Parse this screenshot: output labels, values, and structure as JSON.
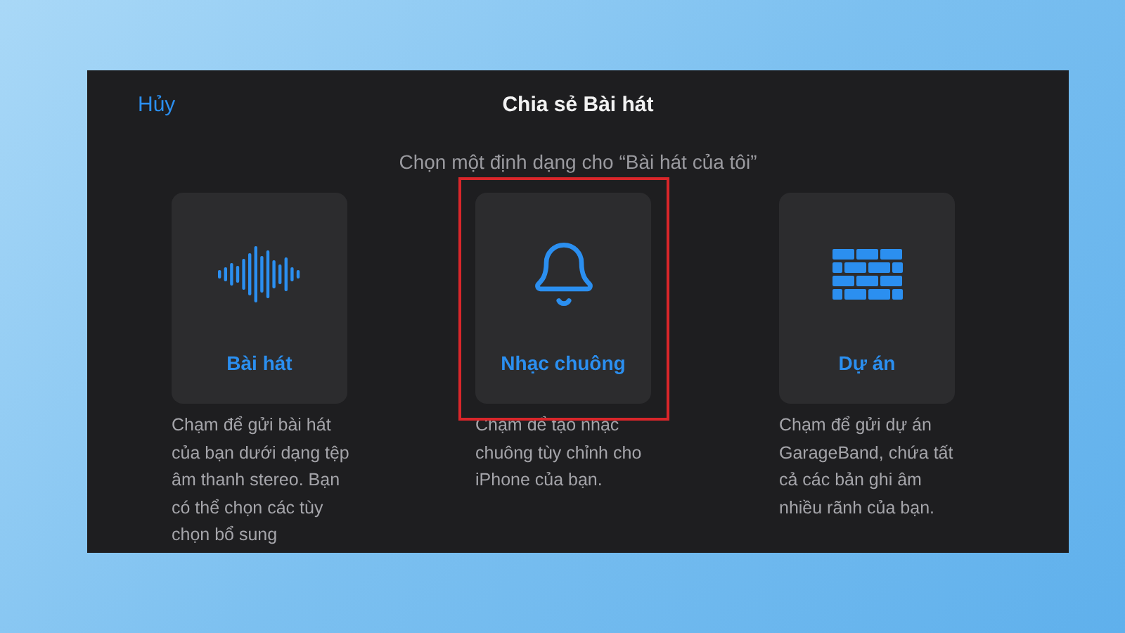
{
  "header": {
    "cancel": "Hủy",
    "title": "Chia sẻ Bài hát"
  },
  "prompt": "Chọn một định dạng cho “Bài hát của tôi”",
  "options": [
    {
      "kind": "song",
      "label": "Bài hát",
      "highlighted": false,
      "description": "Chạm để gửi bài hát của bạn dưới dạng tệp âm thanh stereo. Bạn có thể chọn các tùy chọn bổ sung"
    },
    {
      "kind": "ringtone",
      "label": "Nhạc chuông",
      "highlighted": true,
      "description": "Chạm để tạo nhạc chuông tùy chỉnh cho iPhone của bạn."
    },
    {
      "kind": "project",
      "label": "Dự án",
      "highlighted": false,
      "description": "Chạm để gửi dự án GarageBand, chứa tất cả các bản ghi âm nhiều rãnh của bạn."
    }
  ]
}
